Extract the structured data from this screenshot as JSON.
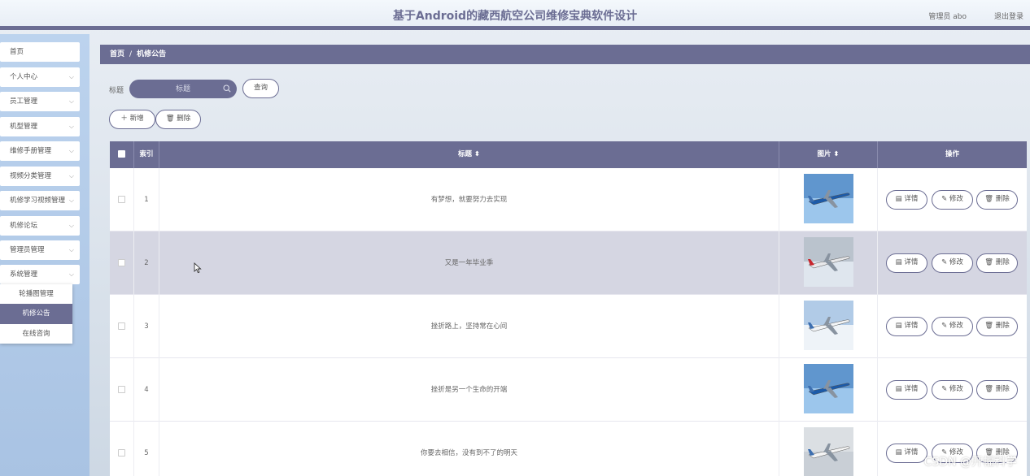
{
  "header": {
    "title": "基于Android的藏西航空公司维修宝典软件设计",
    "user": "管理员 abo",
    "logout": "退出登录"
  },
  "sidebar": {
    "items": [
      {
        "label": "首页",
        "has_arrow": false
      },
      {
        "label": "个人中心",
        "has_arrow": true
      },
      {
        "label": "员工管理",
        "has_arrow": true
      },
      {
        "label": "机型管理",
        "has_arrow": true
      },
      {
        "label": "维修手册管理",
        "has_arrow": true
      },
      {
        "label": "视频分类管理",
        "has_arrow": true
      },
      {
        "label": "机修学习视频管理",
        "has_arrow": true
      },
      {
        "label": "机修论坛",
        "has_arrow": true
      },
      {
        "label": "管理员管理",
        "has_arrow": true
      },
      {
        "label": "系统管理",
        "has_arrow": true
      }
    ],
    "submenu": [
      {
        "label": "轮播图管理",
        "active": false
      },
      {
        "label": "机修公告",
        "active": true
      },
      {
        "label": "在线咨询",
        "active": false
      }
    ]
  },
  "breadcrumb": {
    "home": "首页",
    "sep": "/",
    "current": "机修公告"
  },
  "search": {
    "label": "标题",
    "placeholder": "标题",
    "query_button": "查询"
  },
  "actions": {
    "add": "新增",
    "delete": "删除"
  },
  "table": {
    "headers": {
      "index": "索引",
      "title": "标题",
      "image": "图片",
      "ops": "操作"
    },
    "rows": [
      {
        "index": "1",
        "title": "有梦想，就要努力去实现",
        "image": "airliner-blue-icon",
        "highlight": false
      },
      {
        "index": "2",
        "title": "又是一年毕业季",
        "image": "airliner-white-red-icon",
        "highlight": true
      },
      {
        "index": "3",
        "title": "挫折路上，坚持常在心间",
        "image": "airliner-clouds-icon",
        "highlight": false
      },
      {
        "index": "4",
        "title": "挫折是另一个生命的开端",
        "image": "airliner-blue-icon",
        "highlight": false
      },
      {
        "index": "5",
        "title": "你要去相信，没有到不了的明天",
        "image": "airliner-grey-icon",
        "highlight": false
      }
    ],
    "row_ops": {
      "detail": "详情",
      "edit": "修改",
      "delete": "删除"
    }
  },
  "watermark": "CSDN @开幅科学",
  "colors": {
    "accent": "#6b6d93",
    "highlight_row": "#d5d6e2",
    "sidebar": "#b4cce9"
  }
}
